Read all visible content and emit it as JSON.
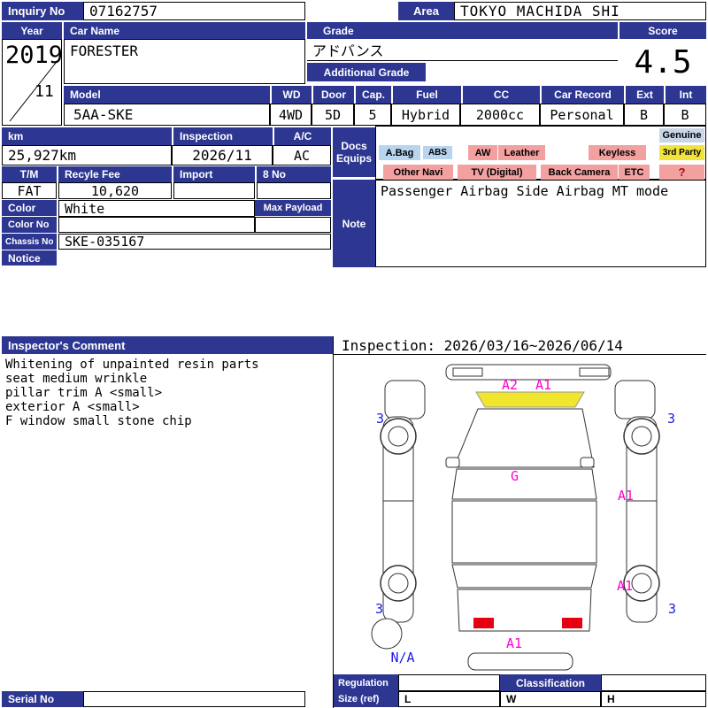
{
  "header": {
    "inquiry_label": "Inquiry No",
    "inquiry_value": "07162757",
    "area_label": "Area",
    "area_value": "TOKYO MACHIDA SHI"
  },
  "main": {
    "year_label": "Year",
    "year": "2019",
    "month": "11",
    "car_name_label": "Car Name",
    "car_name": "FORESTER",
    "grade_label": "Grade",
    "grade_value": "アドバンス",
    "additional_grade_label": "Additional Grade",
    "score_label": "Score",
    "score_value": "4.5",
    "model_label": "Model",
    "model_value": "5AA-SKE",
    "wd_label": "WD",
    "wd_value": "4WD",
    "door_label": "Door",
    "door_value": "5D",
    "cap_label": "Cap.",
    "cap_value": "5",
    "fuel_label": "Fuel",
    "fuel_value": "Hybrid",
    "cc_label": "CC",
    "cc_value": "2000cc",
    "car_record_label": "Car Record",
    "car_record_value": "Personal",
    "ext_label": "Ext",
    "ext_value": "B",
    "int_label": "Int",
    "int_value": "B",
    "km_label": "km",
    "km_value": "25,927km",
    "inspection_label": "Inspection",
    "inspection_value": "2026/11",
    "ac_label": "A/C",
    "ac_value": "AC",
    "tm_label": "T/M",
    "tm_value": "FAT",
    "recycle_fee_label": "Recyle Fee",
    "recycle_fee_value": "10,620",
    "import_label": "Import",
    "import_value": "",
    "eight_no_label": "8 No",
    "eight_no_value": "",
    "color_label": "Color",
    "color_value": "White",
    "max_payload_label": "Max Payload",
    "max_payload_value": "",
    "color_no_label": "Color No",
    "color_no_value": "",
    "chassis_no_label": "Chassis No",
    "chassis_no_value": "SKE-035167",
    "notice_label": "Notice"
  },
  "equipment": {
    "docs_label": "Docs",
    "equips_label": "Equips",
    "genuine_badge": "Genuine",
    "third_party_badge": "3rd Party",
    "unknown_badge": "?",
    "abag": "A.Bag",
    "abs": "ABS",
    "aw": "AW",
    "leather": "Leather",
    "keyless": "Keyless",
    "other_navi": "Other Navi",
    "tv_digital": "TV (Digital)",
    "back_camera": "Back Camera",
    "etc": "ETC"
  },
  "note": {
    "label": "Note",
    "text": "Passenger Airbag Side Airbag MT mode"
  },
  "inspector": {
    "label": "Inspector's Comment",
    "period": "Inspection: 2026/03/16~2026/06/14",
    "lines": [
      "Whitening of unpainted resin parts",
      "seat medium wrinkle",
      "pillar trim A <small>",
      "exterior A <small>",
      "F window small stone chip"
    ]
  },
  "diagram": {
    "front_mark_1": "A2",
    "front_mark_2": "A1",
    "corner_front_left": "3",
    "corner_front_right": "3",
    "corner_rear_left": "3",
    "corner_rear_right": "3",
    "glass_mark": "G",
    "right_side_mark_1": "A1",
    "right_side_mark_2": "A1",
    "rear_mark": "A1",
    "spare_mark": "N/A"
  },
  "footer": {
    "regulation_label": "Regulation",
    "regulation_value": "",
    "classification_label": "Classification",
    "classification_value": "",
    "size_label": "Size (ref)",
    "l_label": "L",
    "w_label": "W",
    "h_label": "H",
    "serial_label": "Serial No",
    "serial_value": ""
  },
  "colors": {
    "navy": "#2d3792",
    "badge_pink": "#f2a0a0",
    "badge_blue": "#b8d4ee",
    "badge_yellow": "#f2e23c",
    "badge_grey": "#c9d6e8",
    "mark_magenta": "#ff00d0",
    "mark_blue": "#1c1ce0",
    "taillight_red": "#e60012",
    "glass_highlight": "#f0e62e"
  }
}
